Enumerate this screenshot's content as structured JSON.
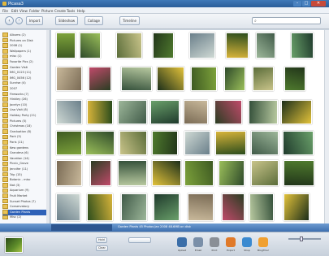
{
  "window": {
    "title": "Picasa3",
    "controls": [
      "–",
      "□",
      "✕"
    ]
  },
  "menu": [
    "File",
    "Edit",
    "View",
    "Folder",
    "Picture",
    "Create",
    "Tools",
    "Help"
  ],
  "toolbar": {
    "import_label": "Import",
    "slideshow_label": "Slideshow",
    "collage_label": "Collage",
    "timeline_label": "Timeline",
    "search_placeholder": ""
  },
  "sidebar": {
    "items": [
      {
        "label": "Albums (2)"
      },
      {
        "label": "Pictures on Disk"
      },
      {
        "label": "2008 (1)"
      },
      {
        "label": "Wallpapers (1)"
      },
      {
        "label": "misc (1)"
      },
      {
        "label": "Favorite Pics (2)"
      },
      {
        "label": "Garden Visit"
      },
      {
        "label": "IMG_0123 (11)"
      },
      {
        "label": "IMG_0456 (12)"
      },
      {
        "label": "Sunrise (4)"
      },
      {
        "label": "2007"
      },
      {
        "label": "Fireworks (7)"
      },
      {
        "label": "Hinkley (26)"
      },
      {
        "label": "Jocelyn (10)"
      },
      {
        "label": "Lisa Visit (8)"
      },
      {
        "label": "Holiday Party (21)"
      },
      {
        "label": "Pictures (5)"
      },
      {
        "label": "Christmas (18)"
      },
      {
        "label": "Graduation (8)"
      },
      {
        "label": "Park (3)"
      },
      {
        "label": "Paris (11)"
      },
      {
        "label": "Kew gardens"
      },
      {
        "label": "Grandma (6)"
      },
      {
        "label": "Vacation (14)"
      },
      {
        "label": "Picnic_Grove"
      },
      {
        "label": "Jennifer (11)"
      },
      {
        "label": "Trip (15)"
      },
      {
        "label": "Botanic - misc"
      },
      {
        "label": "Nat (3)"
      },
      {
        "label": "Aquarium (9)"
      },
      {
        "label": "Fruit Market"
      },
      {
        "label": "Sunset Photos (7)"
      },
      {
        "label": "Conservatory"
      },
      {
        "label": "Garden Plants"
      },
      {
        "label": "Misc (2)"
      }
    ],
    "selected_index": 33
  },
  "strip": {
    "info": "Garden Plants   45 Photos   Jan 2008   48.6MB on disk"
  },
  "tray": {
    "hold_label": "Hold",
    "clear_label": "Clear",
    "buttons": [
      {
        "label": "Upload",
        "icon": "upload-icon",
        "color": "#3b6ea8"
      },
      {
        "label": "Email",
        "icon": "email-icon",
        "color": "#7a8fa8"
      },
      {
        "label": "Print",
        "icon": "print-icon",
        "color": "#8a8f96"
      },
      {
        "label": "Export",
        "icon": "export-icon",
        "color": "#e07a2a"
      },
      {
        "label": "Shop",
        "icon": "shop-icon",
        "color": "#3b8ad0"
      },
      {
        "label": "BlogThis!",
        "icon": "blog-icon",
        "color": "#f0a030"
      }
    ]
  },
  "colors": {
    "accent": "#2f62b8",
    "titlebar": "#3f79b8"
  }
}
